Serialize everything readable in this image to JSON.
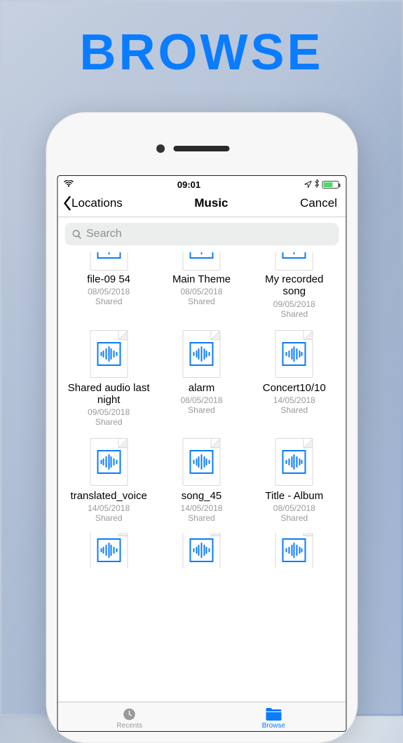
{
  "promo": {
    "title": "BROWSE"
  },
  "status": {
    "time": "09:01"
  },
  "nav": {
    "back_label": "Locations",
    "title": "Music",
    "cancel_label": "Cancel"
  },
  "search": {
    "placeholder": "Search"
  },
  "files": [
    {
      "name": "file-09 54",
      "date": "08/05/2018",
      "status": "Shared",
      "partial": true
    },
    {
      "name": "Main Theme",
      "date": "08/05/2018",
      "status": "Shared",
      "partial": true
    },
    {
      "name": "My recorded song",
      "date": "09/05/2018",
      "status": "Shared",
      "partial": true
    },
    {
      "name": "Shared audio last night",
      "date": "09/05/2018",
      "status": "Shared"
    },
    {
      "name": "alarm",
      "date": "08/05/2018",
      "status": "Shared"
    },
    {
      "name": "Concert10/10",
      "date": "14/05/2018",
      "status": "Shared"
    },
    {
      "name": "translated_voice",
      "date": "14/05/2018",
      "status": "Shared"
    },
    {
      "name": "song_45",
      "date": "14/05/2018",
      "status": "Shared"
    },
    {
      "name": "Title - Album",
      "date": "08/05/2018",
      "status": "Shared"
    }
  ],
  "tabs": {
    "recents": "Recents",
    "browse": "Browse"
  }
}
